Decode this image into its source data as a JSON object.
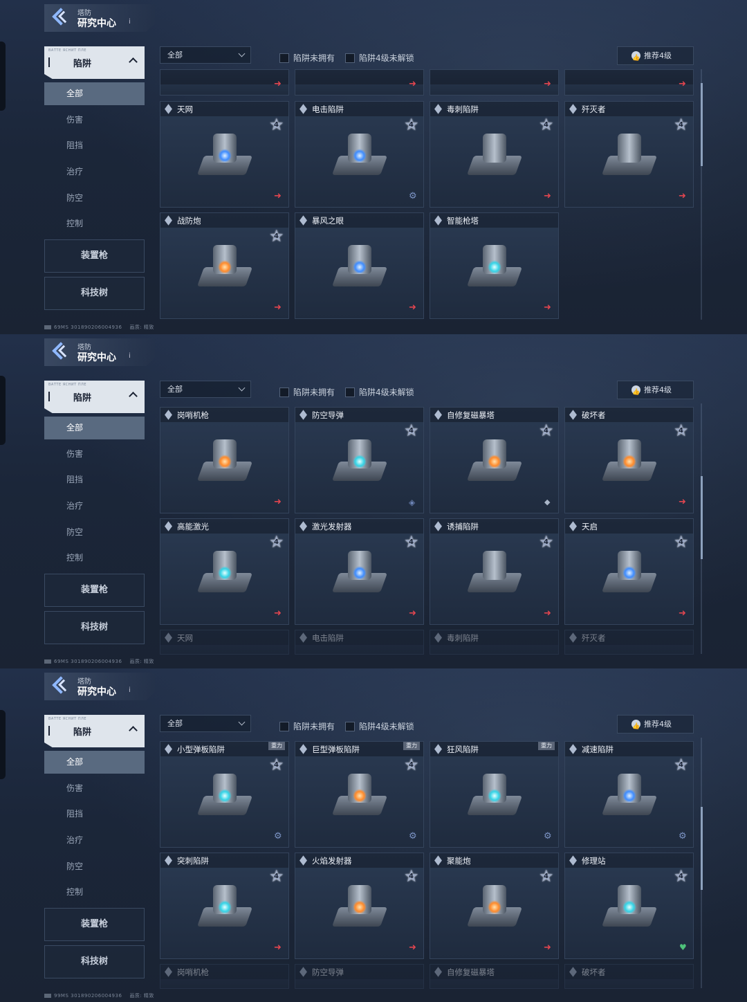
{
  "header": {
    "subtitle": "塔防",
    "title": "研究中心",
    "info": "i"
  },
  "category": {
    "label": "陷阱",
    "deco": "ВАТТЕ ЯСНИТ ПЛЕ"
  },
  "sub_items": [
    "全部",
    "伤害",
    "阻挡",
    "治疗",
    "防空",
    "控制"
  ],
  "buttons": {
    "weapon": "装置枪",
    "tech": "科技树"
  },
  "filter": {
    "value": "全部"
  },
  "checks": {
    "not_owned": "陷阱未拥有",
    "lv4_locked": "陷阱4级未解锁"
  },
  "recommend": "推荐4级",
  "footers": [
    "69MS  301890206004936",
    "69MS  301890206004936",
    "99MS  301890206004936"
  ],
  "footer_extra": "画质: 精致",
  "star_level": "4",
  "tag_gravity": "重力",
  "panels": [
    {
      "partial_top": [
        {
          "arrow": true
        },
        {
          "arrow": true
        },
        {
          "arrow": true
        },
        {
          "arrow": true
        }
      ],
      "rows": [
        [
          {
            "name": "天网",
            "star": true,
            "action": "arrow",
            "glow": "blue"
          },
          {
            "name": "电击陷阱",
            "star": true,
            "action": "gear",
            "glow": "blue"
          },
          {
            "name": "毒刺陷阱",
            "star": true,
            "action": "arrow",
            "glow": "none"
          },
          {
            "name": "歼灭者",
            "star": true,
            "action": "arrow",
            "glow": "none"
          }
        ],
        [
          {
            "name": "战防炮",
            "star": true,
            "action": "arrow",
            "glow": "orange"
          },
          {
            "name": "暴风之眼",
            "star": false,
            "action": "arrow",
            "glow": "blue"
          },
          {
            "name": "智能枪塔",
            "star": false,
            "action": "arrow",
            "glow": "cyan"
          }
        ]
      ]
    },
    {
      "rows": [
        [
          {
            "name": "岗哨机枪",
            "star": false,
            "action": "arrow",
            "glow": "orange"
          },
          {
            "name": "防空导弹",
            "star": true,
            "action": "shield2",
            "glow": "cyan"
          },
          {
            "name": "自修复磁暴塔",
            "star": true,
            "action": "shield",
            "glow": "orange"
          },
          {
            "name": "破坏者",
            "star": true,
            "action": "arrow",
            "glow": "orange"
          }
        ],
        [
          {
            "name": "高能激光",
            "star": true,
            "action": "arrow",
            "glow": "cyan"
          },
          {
            "name": "激光发射器",
            "star": true,
            "action": "arrow",
            "glow": "blue"
          },
          {
            "name": "诱捕陷阱",
            "star": true,
            "action": "arrow",
            "glow": "none"
          },
          {
            "name": "天启",
            "star": true,
            "action": "arrow",
            "glow": "blue"
          }
        ]
      ],
      "next_row": [
        "天网",
        "电击陷阱",
        "毒刺陷阱",
        "歼灭者"
      ]
    },
    {
      "rows": [
        [
          {
            "name": "小型弹板陷阱",
            "star": true,
            "action": "gear",
            "glow": "cyan",
            "tag": true
          },
          {
            "name": "巨型弹板陷阱",
            "star": true,
            "action": "gear",
            "glow": "orange",
            "tag": true
          },
          {
            "name": "狂风陷阱",
            "star": false,
            "action": "gear",
            "glow": "cyan",
            "tag": true
          },
          {
            "name": "减速陷阱",
            "star": true,
            "action": "gear",
            "glow": "blue"
          }
        ],
        [
          {
            "name": "突刺陷阱",
            "star": true,
            "action": "arrow",
            "glow": "cyan"
          },
          {
            "name": "火焰发射器",
            "star": true,
            "action": "arrow",
            "glow": "orange"
          },
          {
            "name": "聚能炮",
            "star": true,
            "action": "arrow",
            "glow": "orange"
          },
          {
            "name": "修理站",
            "star": true,
            "action": "heart",
            "glow": "cyan"
          }
        ]
      ],
      "next_row": [
        "岗哨机枪",
        "防空导弹",
        "自修复磁暴塔",
        "破坏者"
      ]
    }
  ]
}
